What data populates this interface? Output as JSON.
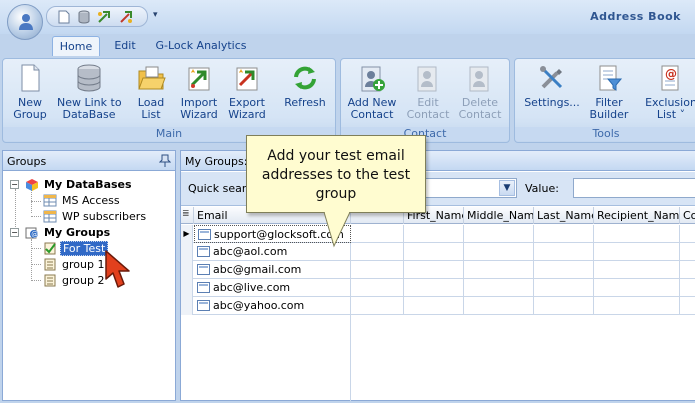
{
  "window": {
    "title": "Address Book"
  },
  "ribbon_tabs": [
    "Home",
    "Edit",
    "G-Lock Analytics"
  ],
  "groups": {
    "main": {
      "label": "Main",
      "buttons": [
        {
          "line1": "New",
          "line2": "Group",
          "icon": "new-document-icon"
        },
        {
          "line1": "New Link to",
          "line2": "DataBase",
          "icon": "database-icon"
        },
        {
          "line1": "Load",
          "line2": "List",
          "icon": "open-folder-icon"
        },
        {
          "line1": "Import",
          "line2": "Wizard",
          "icon": "import-wizard-icon"
        },
        {
          "line1": "Export",
          "line2": "Wizard",
          "icon": "export-wizard-icon"
        },
        {
          "line1": "Refresh",
          "line2": "",
          "icon": "refresh-icon"
        }
      ]
    },
    "contact": {
      "label": "Contact",
      "buttons": [
        {
          "line1": "Add New",
          "line2": "Contact",
          "icon": "add-contact-icon"
        },
        {
          "line1": "Edit",
          "line2": "Contact",
          "icon": "edit-contact-icon"
        },
        {
          "line1": "Delete",
          "line2": "Contact",
          "icon": "delete-contact-icon"
        }
      ]
    },
    "tools": {
      "label": "Tools",
      "buttons": [
        {
          "line1": "Settings...",
          "line2": "",
          "icon": "settings-tools-icon"
        },
        {
          "line1": "Filter",
          "line2": "Builder",
          "icon": "filter-builder-icon"
        },
        {
          "line1": "Exclusion",
          "line2": "List ˅",
          "icon": "exclusion-list-icon"
        }
      ]
    }
  },
  "left_panel": {
    "title": "Groups",
    "tree": {
      "databases": {
        "label": "My DataBases",
        "children": [
          "MS Access",
          "WP subscribers"
        ]
      },
      "groups": {
        "label": "My Groups",
        "children": [
          "For Test",
          "group 1",
          "group 2"
        ]
      }
    }
  },
  "right_panel": {
    "header": "My Groups: F",
    "search": {
      "label": "Quick search",
      "value_label": "Value:"
    },
    "columns": [
      "Email",
      "",
      "First_Name",
      "Middle_Name",
      "Last_Name",
      "Recipient_Name",
      "Co"
    ],
    "rows": [
      "support@glocksoft.com",
      "abc@aol.com",
      "abc@gmail.com",
      "abc@live.com",
      "abc@yahoo.com"
    ]
  },
  "callout": {
    "text": "Add your test email addresses to the test group"
  },
  "colors": {
    "ribbon_bg": "#bfd3ec",
    "accent": "#15428b",
    "selection": "#3169c6",
    "callout_bg": "#fffcd0"
  }
}
